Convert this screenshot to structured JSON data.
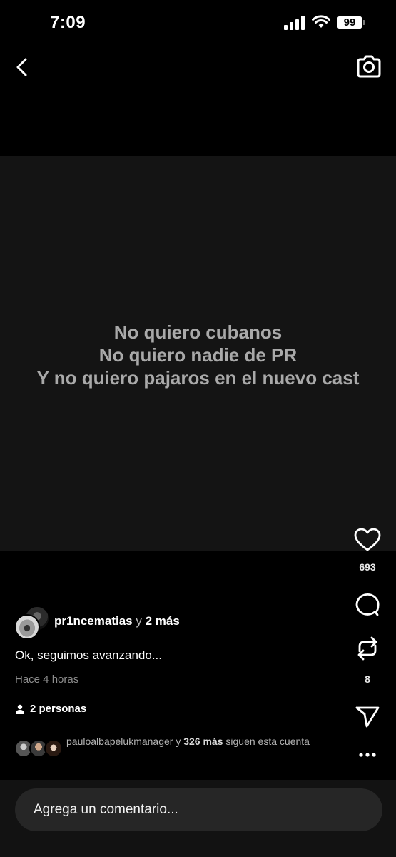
{
  "status_bar": {
    "time": "7:09",
    "battery": "99"
  },
  "story": {
    "lines": [
      "No quiero cubanos",
      "No quiero nadie de PR",
      "Y no quiero pajaros en el nuevo cast"
    ]
  },
  "actions": {
    "like_count": "693",
    "repost_count": "8"
  },
  "post": {
    "author": "pr1ncematias",
    "author_connector": "y",
    "author_more": "2 más",
    "caption": "Ok, seguimos avanzando...",
    "timestamp": "Hace 4 horas",
    "audience": "2 personas"
  },
  "followers": {
    "name": "paulo​albapelukmanager",
    "connector": "y",
    "more": "326 más",
    "suffix": "siguen esta cuenta"
  },
  "composer": {
    "placeholder": "Agrega un comentario..."
  },
  "icons": {
    "back": "chevron-left-icon",
    "camera": "camera-icon",
    "like": "heart-icon",
    "comment": "comment-bubble-icon",
    "repost": "repost-icon",
    "share": "send-icon",
    "more": "more-dots-icon",
    "audience": "person-icon"
  }
}
